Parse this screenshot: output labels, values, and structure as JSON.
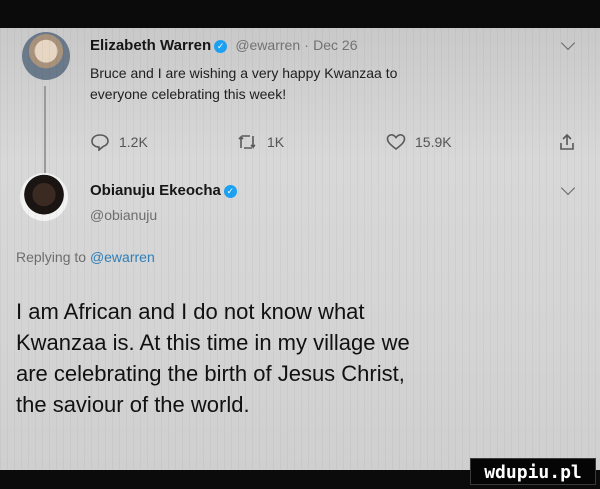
{
  "tweet1": {
    "author_name": "Elizabeth Warren",
    "handle": "@ewarren",
    "separator": "·",
    "date": "Dec 26",
    "text_line1": "Bruce and I are wishing a very happy Kwanzaa to",
    "text_line2": "everyone celebrating this week!",
    "reply_count": "1.2K",
    "retweet_count": "1K",
    "like_count": "15.9K"
  },
  "tweet2": {
    "author_name": "Obianuju Ekeocha",
    "handle": "@obianuju",
    "replying_prefix": "Replying to",
    "replying_to": "@ewarren",
    "text_line1": "I am African and I do not know what",
    "text_line2": "Kwanzaa is. At this time in my village we",
    "text_line3": "are celebrating the birth of Jesus Christ,",
    "text_line4": "the saviour of the world."
  },
  "watermark": "wdupiu.pl",
  "icons": {
    "verified": "verified-badge-icon",
    "reply": "reply-icon",
    "retweet": "retweet-icon",
    "like": "heart-icon",
    "share": "share-icon",
    "more": "chevron-down-icon"
  },
  "colors": {
    "verified": "#1da1f2",
    "mention": "#2f7fb8",
    "background": "#d4d4d4"
  }
}
